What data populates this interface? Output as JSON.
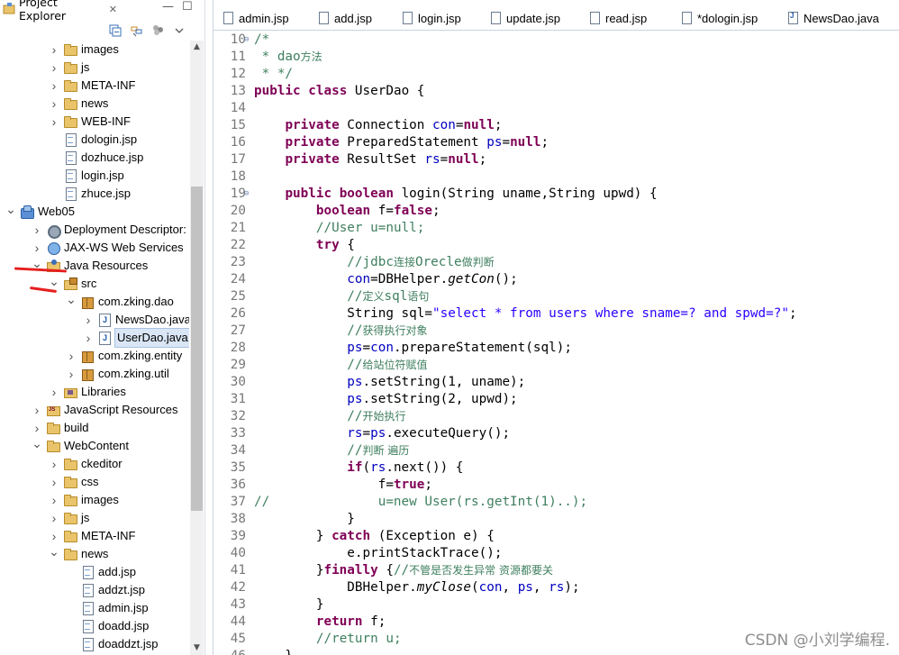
{
  "explorer": {
    "title": "Project Explorer",
    "close_glyph": "✕",
    "min_glyph": "—",
    "max_glyph": "☐",
    "toolbar": [
      "collapse-all-icon",
      "link-with-editor-icon",
      "view-menu-icon",
      "chevron-down-icon"
    ],
    "tree": [
      {
        "label": "images",
        "indent": 2,
        "twisty": ">",
        "icon": "folder"
      },
      {
        "label": "js",
        "indent": 2,
        "twisty": ">",
        "icon": "folder"
      },
      {
        "label": "META-INF",
        "indent": 2,
        "twisty": ">",
        "icon": "folder"
      },
      {
        "label": "news",
        "indent": 2,
        "twisty": ">",
        "icon": "folder"
      },
      {
        "label": "WEB-INF",
        "indent": 2,
        "twisty": ">",
        "icon": "folder"
      },
      {
        "label": "dologin.jsp",
        "indent": 2,
        "twisty": "",
        "icon": "file"
      },
      {
        "label": "dozhuce.jsp",
        "indent": 2,
        "twisty": "",
        "icon": "file"
      },
      {
        "label": "login.jsp",
        "indent": 2,
        "twisty": "",
        "icon": "file"
      },
      {
        "label": "zhuce.jsp",
        "indent": 2,
        "twisty": "",
        "icon": "file"
      },
      {
        "label": "Web05",
        "indent": 0,
        "twisty": "v",
        "icon": "project"
      },
      {
        "label": "Deployment Descriptor: Web05",
        "indent": 1,
        "twisty": ">",
        "icon": "gear"
      },
      {
        "label": "JAX-WS Web Services",
        "indent": 1,
        "twisty": ">",
        "icon": "globe"
      },
      {
        "label": "Java Resources",
        "indent": 1,
        "twisty": "v",
        "icon": "javares"
      },
      {
        "label": "src",
        "indent": 2,
        "twisty": "v",
        "icon": "srcfolder"
      },
      {
        "label": "com.zking.dao",
        "indent": 3,
        "twisty": "v",
        "icon": "pkg"
      },
      {
        "label": "NewsDao.java",
        "indent": 4,
        "twisty": ">",
        "icon": "java"
      },
      {
        "label": "UserDao.java",
        "indent": 4,
        "twisty": ">",
        "icon": "java",
        "selected": true
      },
      {
        "label": "com.zking.entity",
        "indent": 3,
        "twisty": ">",
        "icon": "pkg"
      },
      {
        "label": "com.zking.util",
        "indent": 3,
        "twisty": ">",
        "icon": "pkg"
      },
      {
        "label": "Libraries",
        "indent": 2,
        "twisty": ">",
        "icon": "lib"
      },
      {
        "label": "JavaScript Resources",
        "indent": 1,
        "twisty": ">",
        "icon": "jsres"
      },
      {
        "label": "build",
        "indent": 1,
        "twisty": ">",
        "icon": "folder"
      },
      {
        "label": "WebContent",
        "indent": 1,
        "twisty": "v",
        "icon": "folder"
      },
      {
        "label": "ckeditor",
        "indent": 2,
        "twisty": ">",
        "icon": "folder"
      },
      {
        "label": "css",
        "indent": 2,
        "twisty": ">",
        "icon": "folder"
      },
      {
        "label": "images",
        "indent": 2,
        "twisty": ">",
        "icon": "folder"
      },
      {
        "label": "js",
        "indent": 2,
        "twisty": ">",
        "icon": "folder"
      },
      {
        "label": "META-INF",
        "indent": 2,
        "twisty": ">",
        "icon": "folder"
      },
      {
        "label": "news",
        "indent": 2,
        "twisty": "v",
        "icon": "folder"
      },
      {
        "label": "add.jsp",
        "indent": 3,
        "twisty": "",
        "icon": "file"
      },
      {
        "label": "addzt.jsp",
        "indent": 3,
        "twisty": "",
        "icon": "file"
      },
      {
        "label": "admin.jsp",
        "indent": 3,
        "twisty": "",
        "icon": "file"
      },
      {
        "label": "doadd.jsp",
        "indent": 3,
        "twisty": "",
        "icon": "file"
      },
      {
        "label": "doaddzt.jsp",
        "indent": 3,
        "twisty": "",
        "icon": "file"
      }
    ]
  },
  "editor": {
    "tabs": [
      {
        "label": "admin.jsp",
        "icon": "jsp",
        "width": 106
      },
      {
        "label": "add.jsp",
        "icon": "jsp",
        "width": 93
      },
      {
        "label": "login.jsp",
        "icon": "jsp",
        "width": 98
      },
      {
        "label": "update.jsp",
        "icon": "jsp",
        "width": 110
      },
      {
        "label": "read.jsp",
        "icon": "jsp",
        "width": 102
      },
      {
        "label": "*dologin.jsp",
        "icon": "jsp",
        "width": 118
      },
      {
        "label": "NewsDao.java",
        "icon": "java",
        "width": 135
      }
    ],
    "code": [
      {
        "n": "10",
        "fold": "⊖",
        "parts": [
          [
            "cm",
            "/*"
          ]
        ]
      },
      {
        "n": "11",
        "parts": [
          [
            "cm",
            " * "
          ],
          [
            "cm",
            "dao"
          ],
          [
            "cm cn",
            "方法"
          ]
        ]
      },
      {
        "n": "12",
        "parts": [
          [
            "cm",
            " * */"
          ]
        ]
      },
      {
        "n": "13",
        "parts": [
          [
            "kw",
            "public"
          ],
          [
            "",
            " "
          ],
          [
            "kw",
            "class"
          ],
          [
            "",
            " UserDao {"
          ]
        ]
      },
      {
        "n": "14",
        "parts": [
          [
            "",
            ""
          ]
        ]
      },
      {
        "n": "15",
        "parts": [
          [
            "",
            "    "
          ],
          [
            "kw",
            "private"
          ],
          [
            "",
            " Connection "
          ],
          [
            "fd",
            "con"
          ],
          [
            "",
            "="
          ],
          [
            "kw",
            "null"
          ],
          [
            "",
            ";"
          ]
        ]
      },
      {
        "n": "16",
        "parts": [
          [
            "",
            "    "
          ],
          [
            "kw",
            "private"
          ],
          [
            "",
            " PreparedStatement "
          ],
          [
            "fd",
            "ps"
          ],
          [
            "",
            "="
          ],
          [
            "kw",
            "null"
          ],
          [
            "",
            ";"
          ]
        ]
      },
      {
        "n": "17",
        "parts": [
          [
            "",
            "    "
          ],
          [
            "kw",
            "private"
          ],
          [
            "",
            " ResultSet "
          ],
          [
            "fd",
            "rs"
          ],
          [
            "",
            "="
          ],
          [
            "kw",
            "null"
          ],
          [
            "",
            ";"
          ]
        ]
      },
      {
        "n": "18",
        "parts": [
          [
            "",
            ""
          ]
        ]
      },
      {
        "n": "19",
        "fold": "⊖",
        "parts": [
          [
            "",
            "    "
          ],
          [
            "kw",
            "public"
          ],
          [
            "",
            " "
          ],
          [
            "kw",
            "boolean"
          ],
          [
            "",
            " login(String uname,String upwd) {"
          ]
        ]
      },
      {
        "n": "20",
        "parts": [
          [
            "",
            "        "
          ],
          [
            "kw",
            "boolean"
          ],
          [
            "",
            " f="
          ],
          [
            "kw",
            "false"
          ],
          [
            "",
            ";"
          ]
        ]
      },
      {
        "n": "21",
        "parts": [
          [
            "",
            "        "
          ],
          [
            "cm",
            "//User u=null;"
          ]
        ]
      },
      {
        "n": "22",
        "parts": [
          [
            "",
            "        "
          ],
          [
            "kw",
            "try"
          ],
          [
            "",
            " {"
          ]
        ]
      },
      {
        "n": "23",
        "parts": [
          [
            "",
            "            "
          ],
          [
            "cm",
            "//jdbc"
          ],
          [
            "cm cn",
            "连接"
          ],
          [
            "cm",
            "Orecle"
          ],
          [
            "cm cn",
            "做判断"
          ]
        ]
      },
      {
        "n": "24",
        "parts": [
          [
            "",
            "            "
          ],
          [
            "fd",
            "con"
          ],
          [
            "",
            "=DBHelper."
          ],
          [
            "it",
            "getCon"
          ],
          [
            "",
            "();"
          ]
        ]
      },
      {
        "n": "25",
        "parts": [
          [
            "",
            "            "
          ],
          [
            "cm",
            "//"
          ],
          [
            "cm cn",
            "定义"
          ],
          [
            "cm",
            "sql"
          ],
          [
            "cm cn",
            "语句"
          ]
        ]
      },
      {
        "n": "26",
        "parts": [
          [
            "",
            "            String sql="
          ],
          [
            "st",
            "\"select * from users where sname=? and spwd=?\""
          ],
          [
            "",
            ";"
          ]
        ]
      },
      {
        "n": "27",
        "parts": [
          [
            "",
            "            "
          ],
          [
            "cm",
            "//"
          ],
          [
            "cm cn",
            "获得执行对象"
          ]
        ]
      },
      {
        "n": "28",
        "parts": [
          [
            "",
            "            "
          ],
          [
            "fd",
            "ps"
          ],
          [
            "",
            "="
          ],
          [
            "fd",
            "con"
          ],
          [
            "",
            ".prepareStatement(sql);"
          ]
        ]
      },
      {
        "n": "29",
        "parts": [
          [
            "",
            "            "
          ],
          [
            "cm",
            "//"
          ],
          [
            "cm cn",
            "给站位符赋值"
          ]
        ]
      },
      {
        "n": "30",
        "parts": [
          [
            "",
            "            "
          ],
          [
            "fd",
            "ps"
          ],
          [
            "",
            ".setString(1, uname);"
          ]
        ]
      },
      {
        "n": "31",
        "parts": [
          [
            "",
            "            "
          ],
          [
            "fd",
            "ps"
          ],
          [
            "",
            ".setString(2, upwd);"
          ]
        ]
      },
      {
        "n": "32",
        "parts": [
          [
            "",
            "            "
          ],
          [
            "cm",
            "//"
          ],
          [
            "cm cn",
            "开始执行"
          ]
        ]
      },
      {
        "n": "33",
        "parts": [
          [
            "",
            "            "
          ],
          [
            "fd",
            "rs"
          ],
          [
            "",
            "="
          ],
          [
            "fd",
            "ps"
          ],
          [
            "",
            ".executeQuery();"
          ]
        ]
      },
      {
        "n": "34",
        "parts": [
          [
            "",
            "            "
          ],
          [
            "cm",
            "//"
          ],
          [
            "cm cn",
            "判断 遍历"
          ]
        ]
      },
      {
        "n": "35",
        "parts": [
          [
            "",
            "            "
          ],
          [
            "kw",
            "if"
          ],
          [
            "",
            "("
          ],
          [
            "fd",
            "rs"
          ],
          [
            "",
            ".next()) {"
          ]
        ]
      },
      {
        "n": "36",
        "parts": [
          [
            "",
            "                f="
          ],
          [
            "kw",
            "true"
          ],
          [
            "",
            ";"
          ]
        ]
      },
      {
        "n": "37",
        "parts": [
          [
            "cm",
            "//              u=new User(rs.getInt(1)..);"
          ]
        ]
      },
      {
        "n": "38",
        "parts": [
          [
            "",
            "            }"
          ]
        ]
      },
      {
        "n": "39",
        "parts": [
          [
            "",
            "        } "
          ],
          [
            "kw",
            "catch"
          ],
          [
            "",
            " (Exception e) {"
          ]
        ]
      },
      {
        "n": "40",
        "parts": [
          [
            "",
            "            e.printStackTrace();"
          ]
        ]
      },
      {
        "n": "41",
        "parts": [
          [
            "",
            "        }"
          ],
          [
            "kw",
            "finally"
          ],
          [
            "",
            " {"
          ],
          [
            "cm",
            "//"
          ],
          [
            "cm cn",
            "不管是否发生异常 资源都要关"
          ]
        ]
      },
      {
        "n": "42",
        "parts": [
          [
            "",
            "            DBHelper."
          ],
          [
            "it",
            "myClose"
          ],
          [
            "",
            "("
          ],
          [
            "fd",
            "con"
          ],
          [
            "",
            ", "
          ],
          [
            "fd",
            "ps"
          ],
          [
            "",
            ", "
          ],
          [
            "fd",
            "rs"
          ],
          [
            "",
            ");"
          ]
        ]
      },
      {
        "n": "43",
        "parts": [
          [
            "",
            "        }"
          ]
        ]
      },
      {
        "n": "44",
        "parts": [
          [
            "",
            "        "
          ],
          [
            "kw",
            "return"
          ],
          [
            "",
            " f;"
          ]
        ]
      },
      {
        "n": "45",
        "parts": [
          [
            "",
            "        "
          ],
          [
            "cm",
            "//return u;"
          ]
        ]
      },
      {
        "n": "46",
        "parts": [
          [
            "",
            "    }"
          ]
        ]
      }
    ]
  },
  "watermark": "CSDN @小刘学编程.",
  "colors": {
    "keyword": "#7f0055",
    "comment": "#3f7f5f",
    "field": "#0000c0",
    "string": "#2a00ff",
    "selection": "#d9e6f5",
    "annotation_red": "#e61e1e"
  }
}
